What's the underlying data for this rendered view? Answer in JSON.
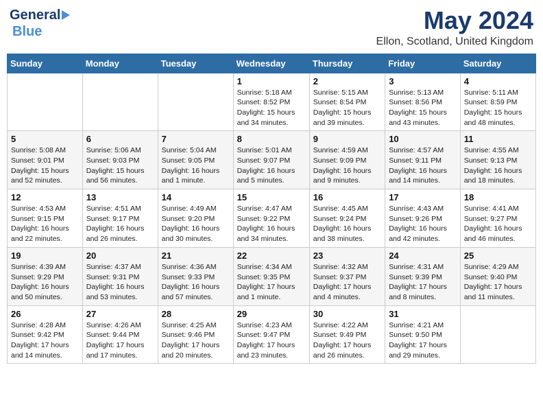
{
  "header": {
    "logo_general": "General",
    "logo_blue": "Blue",
    "month": "May 2024",
    "location": "Ellon, Scotland, United Kingdom"
  },
  "calendar": {
    "days_of_week": [
      "Sunday",
      "Monday",
      "Tuesday",
      "Wednesday",
      "Thursday",
      "Friday",
      "Saturday"
    ],
    "weeks": [
      [
        {
          "day": "",
          "sunrise": "",
          "sunset": "",
          "daylight": ""
        },
        {
          "day": "",
          "sunrise": "",
          "sunset": "",
          "daylight": ""
        },
        {
          "day": "",
          "sunrise": "",
          "sunset": "",
          "daylight": ""
        },
        {
          "day": "1",
          "sunrise": "Sunrise: 5:18 AM",
          "sunset": "Sunset: 8:52 PM",
          "daylight": "Daylight: 15 hours and 34 minutes."
        },
        {
          "day": "2",
          "sunrise": "Sunrise: 5:15 AM",
          "sunset": "Sunset: 8:54 PM",
          "daylight": "Daylight: 15 hours and 39 minutes."
        },
        {
          "day": "3",
          "sunrise": "Sunrise: 5:13 AM",
          "sunset": "Sunset: 8:56 PM",
          "daylight": "Daylight: 15 hours and 43 minutes."
        },
        {
          "day": "4",
          "sunrise": "Sunrise: 5:11 AM",
          "sunset": "Sunset: 8:59 PM",
          "daylight": "Daylight: 15 hours and 48 minutes."
        }
      ],
      [
        {
          "day": "5",
          "sunrise": "Sunrise: 5:08 AM",
          "sunset": "Sunset: 9:01 PM",
          "daylight": "Daylight: 15 hours and 52 minutes."
        },
        {
          "day": "6",
          "sunrise": "Sunrise: 5:06 AM",
          "sunset": "Sunset: 9:03 PM",
          "daylight": "Daylight: 15 hours and 56 minutes."
        },
        {
          "day": "7",
          "sunrise": "Sunrise: 5:04 AM",
          "sunset": "Sunset: 9:05 PM",
          "daylight": "Daylight: 16 hours and 1 minute."
        },
        {
          "day": "8",
          "sunrise": "Sunrise: 5:01 AM",
          "sunset": "Sunset: 9:07 PM",
          "daylight": "Daylight: 16 hours and 5 minutes."
        },
        {
          "day": "9",
          "sunrise": "Sunrise: 4:59 AM",
          "sunset": "Sunset: 9:09 PM",
          "daylight": "Daylight: 16 hours and 9 minutes."
        },
        {
          "day": "10",
          "sunrise": "Sunrise: 4:57 AM",
          "sunset": "Sunset: 9:11 PM",
          "daylight": "Daylight: 16 hours and 14 minutes."
        },
        {
          "day": "11",
          "sunrise": "Sunrise: 4:55 AM",
          "sunset": "Sunset: 9:13 PM",
          "daylight": "Daylight: 16 hours and 18 minutes."
        }
      ],
      [
        {
          "day": "12",
          "sunrise": "Sunrise: 4:53 AM",
          "sunset": "Sunset: 9:15 PM",
          "daylight": "Daylight: 16 hours and 22 minutes."
        },
        {
          "day": "13",
          "sunrise": "Sunrise: 4:51 AM",
          "sunset": "Sunset: 9:17 PM",
          "daylight": "Daylight: 16 hours and 26 minutes."
        },
        {
          "day": "14",
          "sunrise": "Sunrise: 4:49 AM",
          "sunset": "Sunset: 9:20 PM",
          "daylight": "Daylight: 16 hours and 30 minutes."
        },
        {
          "day": "15",
          "sunrise": "Sunrise: 4:47 AM",
          "sunset": "Sunset: 9:22 PM",
          "daylight": "Daylight: 16 hours and 34 minutes."
        },
        {
          "day": "16",
          "sunrise": "Sunrise: 4:45 AM",
          "sunset": "Sunset: 9:24 PM",
          "daylight": "Daylight: 16 hours and 38 minutes."
        },
        {
          "day": "17",
          "sunrise": "Sunrise: 4:43 AM",
          "sunset": "Sunset: 9:26 PM",
          "daylight": "Daylight: 16 hours and 42 minutes."
        },
        {
          "day": "18",
          "sunrise": "Sunrise: 4:41 AM",
          "sunset": "Sunset: 9:27 PM",
          "daylight": "Daylight: 16 hours and 46 minutes."
        }
      ],
      [
        {
          "day": "19",
          "sunrise": "Sunrise: 4:39 AM",
          "sunset": "Sunset: 9:29 PM",
          "daylight": "Daylight: 16 hours and 50 minutes."
        },
        {
          "day": "20",
          "sunrise": "Sunrise: 4:37 AM",
          "sunset": "Sunset: 9:31 PM",
          "daylight": "Daylight: 16 hours and 53 minutes."
        },
        {
          "day": "21",
          "sunrise": "Sunrise: 4:36 AM",
          "sunset": "Sunset: 9:33 PM",
          "daylight": "Daylight: 16 hours and 57 minutes."
        },
        {
          "day": "22",
          "sunrise": "Sunrise: 4:34 AM",
          "sunset": "Sunset: 9:35 PM",
          "daylight": "Daylight: 17 hours and 1 minute."
        },
        {
          "day": "23",
          "sunrise": "Sunrise: 4:32 AM",
          "sunset": "Sunset: 9:37 PM",
          "daylight": "Daylight: 17 hours and 4 minutes."
        },
        {
          "day": "24",
          "sunrise": "Sunrise: 4:31 AM",
          "sunset": "Sunset: 9:39 PM",
          "daylight": "Daylight: 17 hours and 8 minutes."
        },
        {
          "day": "25",
          "sunrise": "Sunrise: 4:29 AM",
          "sunset": "Sunset: 9:40 PM",
          "daylight": "Daylight: 17 hours and 11 minutes."
        }
      ],
      [
        {
          "day": "26",
          "sunrise": "Sunrise: 4:28 AM",
          "sunset": "Sunset: 9:42 PM",
          "daylight": "Daylight: 17 hours and 14 minutes."
        },
        {
          "day": "27",
          "sunrise": "Sunrise: 4:26 AM",
          "sunset": "Sunset: 9:44 PM",
          "daylight": "Daylight: 17 hours and 17 minutes."
        },
        {
          "day": "28",
          "sunrise": "Sunrise: 4:25 AM",
          "sunset": "Sunset: 9:46 PM",
          "daylight": "Daylight: 17 hours and 20 minutes."
        },
        {
          "day": "29",
          "sunrise": "Sunrise: 4:23 AM",
          "sunset": "Sunset: 9:47 PM",
          "daylight": "Daylight: 17 hours and 23 minutes."
        },
        {
          "day": "30",
          "sunrise": "Sunrise: 4:22 AM",
          "sunset": "Sunset: 9:49 PM",
          "daylight": "Daylight: 17 hours and 26 minutes."
        },
        {
          "day": "31",
          "sunrise": "Sunrise: 4:21 AM",
          "sunset": "Sunset: 9:50 PM",
          "daylight": "Daylight: 17 hours and 29 minutes."
        },
        {
          "day": "",
          "sunrise": "",
          "sunset": "",
          "daylight": ""
        }
      ]
    ]
  }
}
